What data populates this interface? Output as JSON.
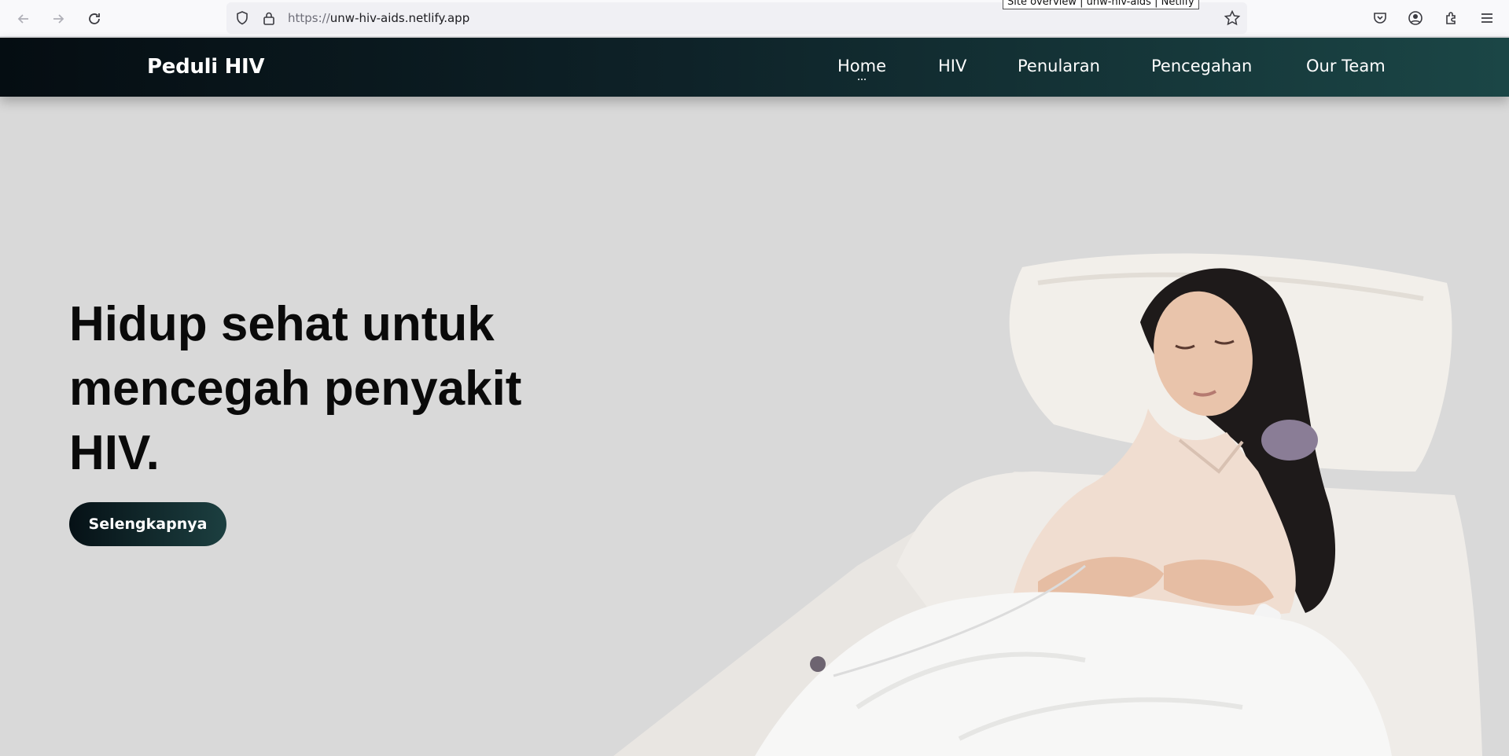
{
  "browser": {
    "url_scheme": "https://",
    "url_host": "unw-hiv-aids.netlify.app",
    "tooltip": "Site overview | unw-hiv-aids | Netlify"
  },
  "site": {
    "brand": "Peduli HIV",
    "nav": [
      {
        "label": "Home"
      },
      {
        "label": "HIV"
      },
      {
        "label": "Penularan"
      },
      {
        "label": "Pencegahan"
      },
      {
        "label": "Our Team"
      }
    ],
    "active_nav": "Home"
  },
  "hero": {
    "title_lines": [
      "Hidup sehat untuk",
      "mencegah penyakit",
      "HIV."
    ],
    "cta_label": "Selengkapnya",
    "image": "woman-in-hospital-bed"
  },
  "colors": {
    "header_dark": "#050d12",
    "header_teal": "#1b4646",
    "hero_bg": "#d9d9d9"
  }
}
